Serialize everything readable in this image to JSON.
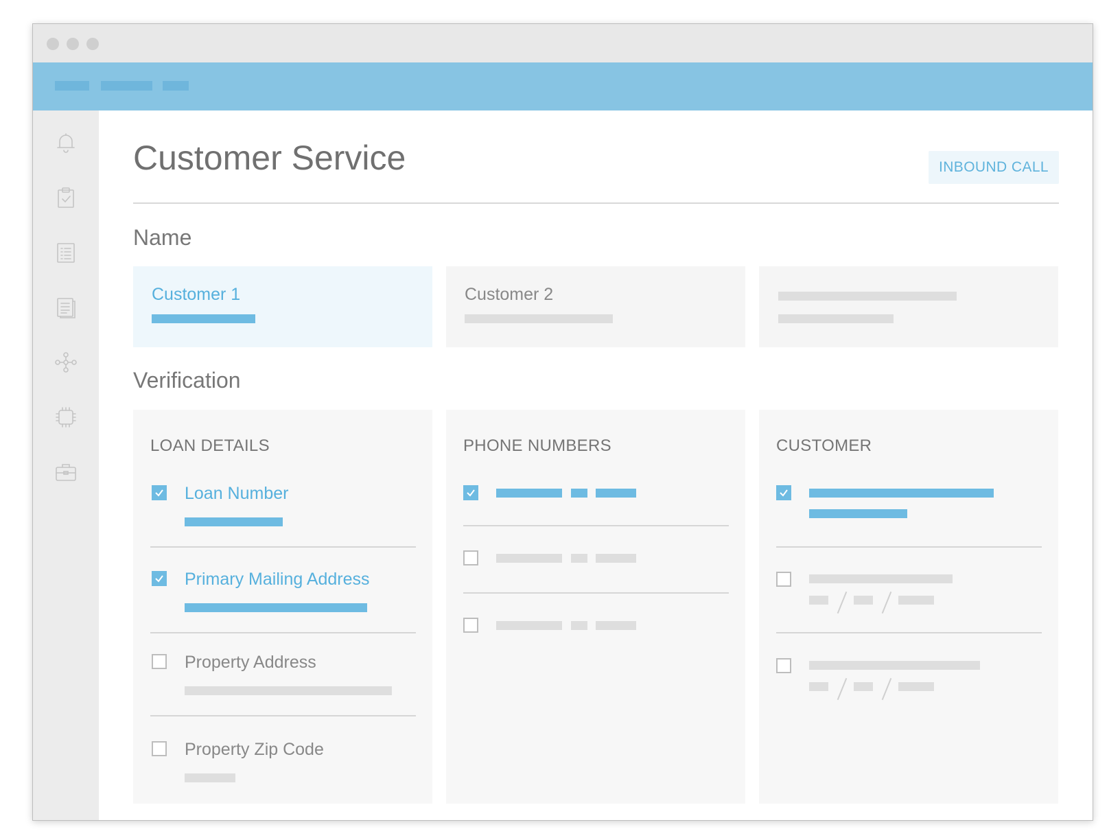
{
  "page": {
    "title": "Customer Service",
    "action_button": "INBOUND CALL"
  },
  "colors": {
    "header_blue": "#87c4e3",
    "accent_blue": "#6ebbe2",
    "text_blue": "#56b0dd",
    "sidebar_gray": "#ececec",
    "card_gray": "#f5f5f5"
  },
  "sidebar": {
    "icons": [
      "bell-icon",
      "clipboard-check-icon",
      "list-icon",
      "document-icon",
      "network-icon",
      "chip-icon",
      "briefcase-icon"
    ]
  },
  "name_section": {
    "label": "Name",
    "customers": [
      {
        "label": "Customer 1",
        "selected": true
      },
      {
        "label": "Customer 2",
        "selected": false
      },
      {
        "label": "",
        "selected": false
      }
    ]
  },
  "verification": {
    "label": "Verification",
    "panels": [
      {
        "heading": "LOAN DETAILS",
        "items": [
          {
            "label": "Loan Number",
            "checked": true
          },
          {
            "label": "Primary Mailing Address",
            "checked": true
          },
          {
            "label": "Property Address",
            "checked": false
          },
          {
            "label": "Property Zip Code",
            "checked": false
          }
        ]
      },
      {
        "heading": "PHONE NUMBERS",
        "items": [
          {
            "checked": true
          },
          {
            "checked": false
          },
          {
            "checked": false
          }
        ]
      },
      {
        "heading": "CUSTOMER",
        "items": [
          {
            "checked": true
          },
          {
            "checked": false
          },
          {
            "checked": false
          }
        ]
      }
    ]
  }
}
